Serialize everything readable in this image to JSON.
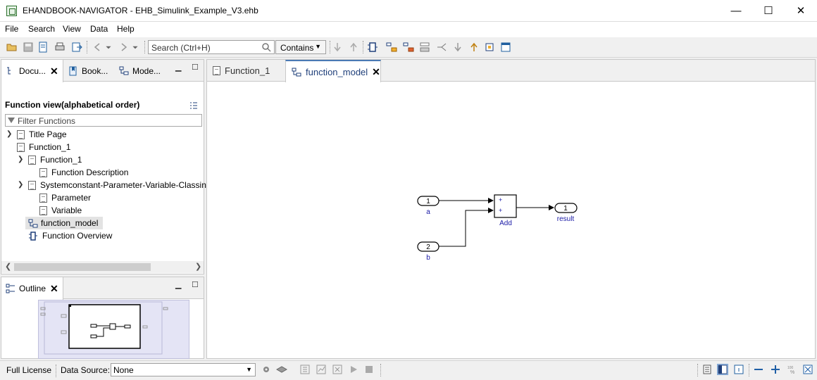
{
  "window": {
    "title": "EHANDBOOK-NAVIGATOR - EHB_Simulink_Example_V3.ehb",
    "minimize": "—",
    "maximize": "☐",
    "close": "✕"
  },
  "menu": {
    "file": "File",
    "search": "Search",
    "view": "View",
    "data": "Data",
    "help": "Help"
  },
  "toolbar": {
    "search_placeholder": "Search (Ctrl+H)",
    "search_mode": "Contains"
  },
  "left_tabs": [
    {
      "label": "Docu..."
    },
    {
      "label": "Book..."
    },
    {
      "label": "Mode..."
    }
  ],
  "function_view": {
    "title": "Function view(alphabetical order)",
    "filter_placeholder": "Filter Functions",
    "tree": [
      {
        "label": "Title Page"
      },
      {
        "label": "Function_1"
      },
      {
        "label": "Function_1"
      },
      {
        "label": "Function Description"
      },
      {
        "label": "Systemconstant-Parameter-Variable-Classin"
      },
      {
        "label": "Parameter"
      },
      {
        "label": "Variable"
      },
      {
        "label": "function_model"
      },
      {
        "label": "Function Overview"
      }
    ]
  },
  "outline": {
    "title": "Outline"
  },
  "editor_tabs": [
    {
      "label": "Function_1"
    },
    {
      "label": "function_model"
    }
  ],
  "diagram": {
    "inport1": {
      "number": "1",
      "name": "a"
    },
    "inport2": {
      "number": "2",
      "name": "b"
    },
    "add_block": {
      "name": "Add",
      "sign1": "+",
      "sign2": "+"
    },
    "outport": {
      "number": "1",
      "name": "result"
    }
  },
  "status": {
    "license": "Full License",
    "data_source_label": "Data Source:",
    "data_source_value": "None"
  },
  "colors": {
    "block_label": "#1a1aa6",
    "active_tab": "#1f3f7a",
    "outline_bg": "#e4e4f5"
  }
}
